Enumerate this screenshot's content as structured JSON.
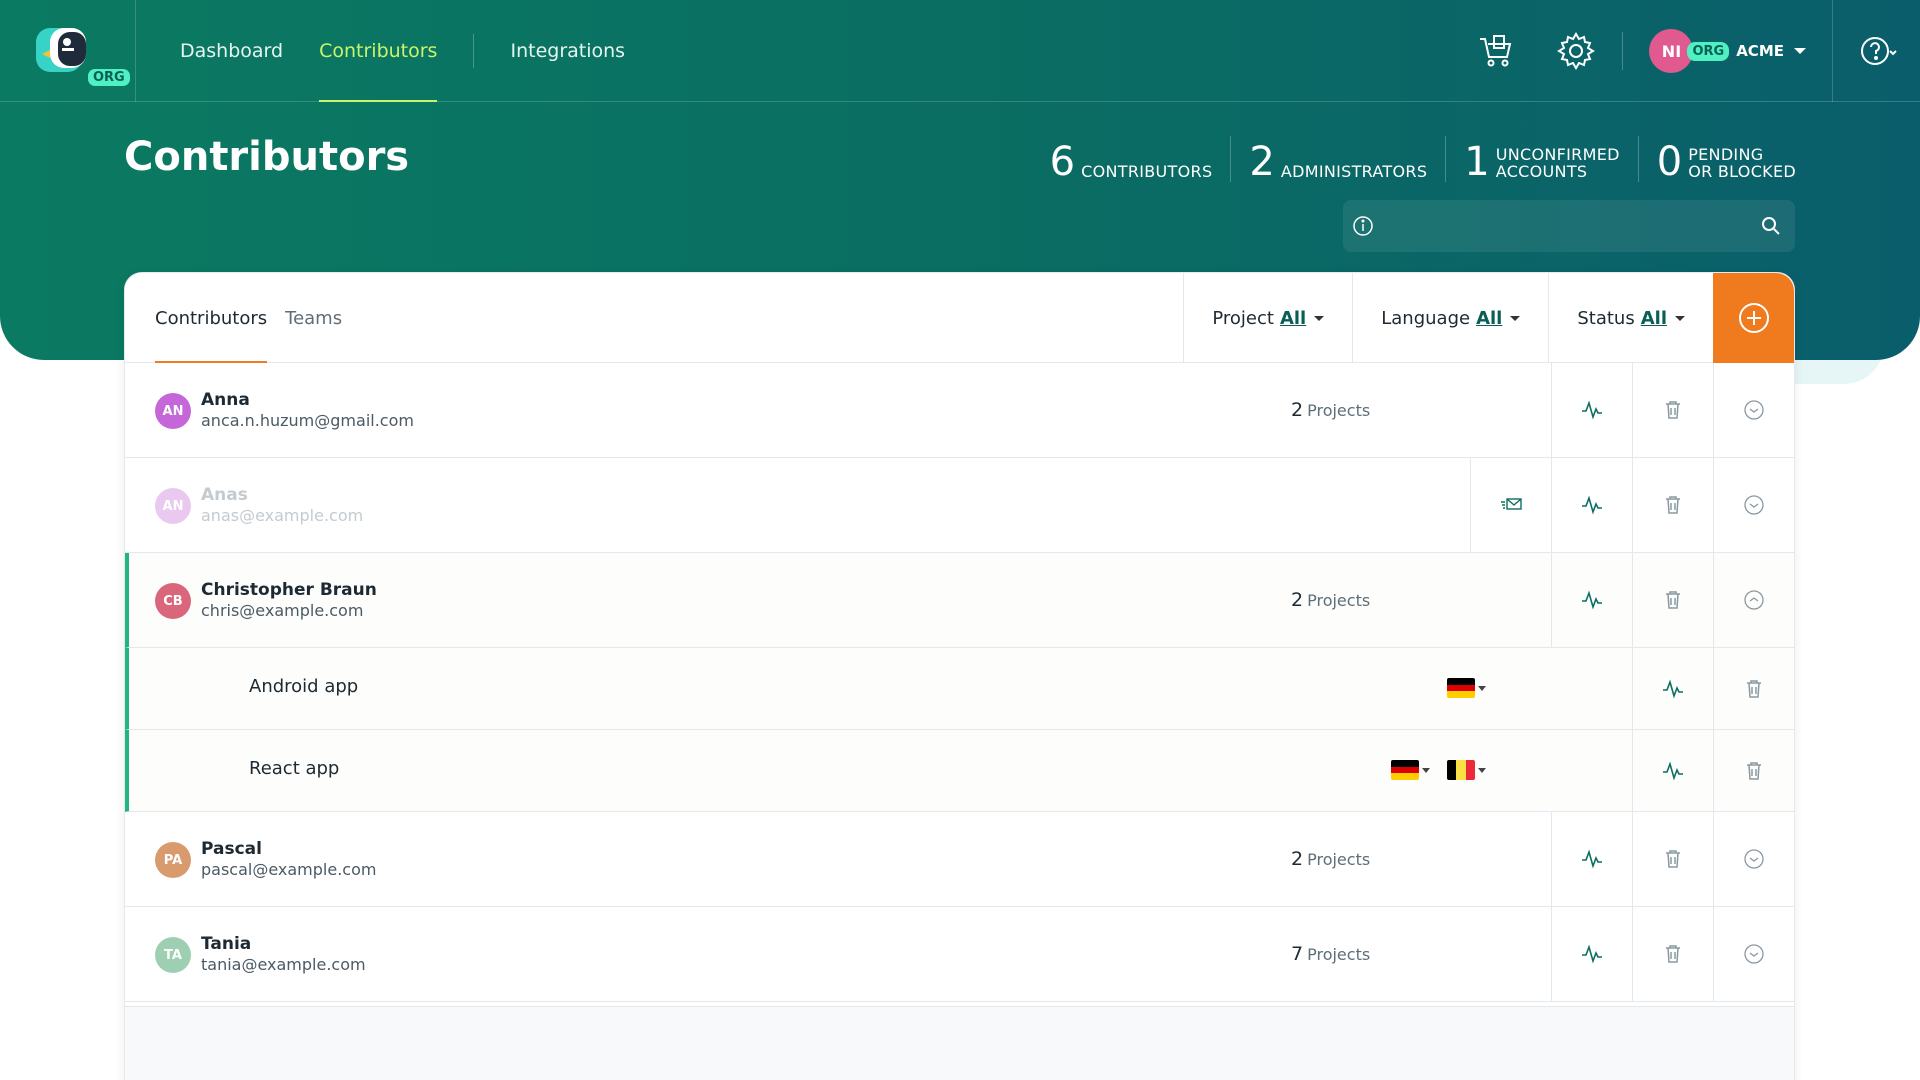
{
  "nav": {
    "dashboard": "Dashboard",
    "contributors": "Contributors",
    "integrations": "Integrations"
  },
  "logo": {
    "badge": "ORG"
  },
  "user": {
    "initials": "NI",
    "org_badge": "ORG",
    "org_name": "ACME"
  },
  "page": {
    "title": "Contributors"
  },
  "stats": [
    {
      "num": "6",
      "label": "CONTRIBUTORS",
      "label2": ""
    },
    {
      "num": "2",
      "label": "ADMINISTRATORS",
      "label2": ""
    },
    {
      "num": "1",
      "label": "UNCONFIRMED",
      "label2": "ACCOUNTS"
    },
    {
      "num": "0",
      "label": "PENDING",
      "label2": "OR BLOCKED"
    }
  ],
  "search": {
    "value": ""
  },
  "tabs": {
    "contributors": "Contributors",
    "teams": "Teams"
  },
  "filters": {
    "project_label": "Project",
    "project_value": "All",
    "language_label": "Language",
    "language_value": "All",
    "status_label": "Status",
    "status_value": "All"
  },
  "rows": [
    {
      "initials": "AN",
      "name": "Anna",
      "email": "anca.n.huzum@gmail.com",
      "count": "2",
      "count_label": "Projects",
      "avatar_color": "#c566d9"
    },
    {
      "initials": "AN",
      "name": "Anas",
      "email": "anas@example.com",
      "avatar_color": "#c566d9"
    },
    {
      "initials": "CB",
      "name": "Christopher Braun",
      "email": "chris@example.com",
      "count": "2",
      "count_label": "Projects",
      "avatar_color": "#d9667a"
    },
    {
      "initials": "PA",
      "name": "Pascal",
      "email": "pascal@example.com",
      "count": "2",
      "count_label": "Projects",
      "avatar_color": "#d99a6e"
    },
    {
      "initials": "TA",
      "name": "Tania",
      "email": "tania@example.com",
      "count": "7",
      "count_label": "Projects",
      "avatar_color": "#9fcfb2"
    }
  ],
  "sub_rows": [
    {
      "title": "Android app"
    },
    {
      "title": "React app"
    }
  ],
  "colors": {
    "accent": "#ef7b1e",
    "brand": "#0a6e62",
    "highlight": "#c8f56a"
  }
}
